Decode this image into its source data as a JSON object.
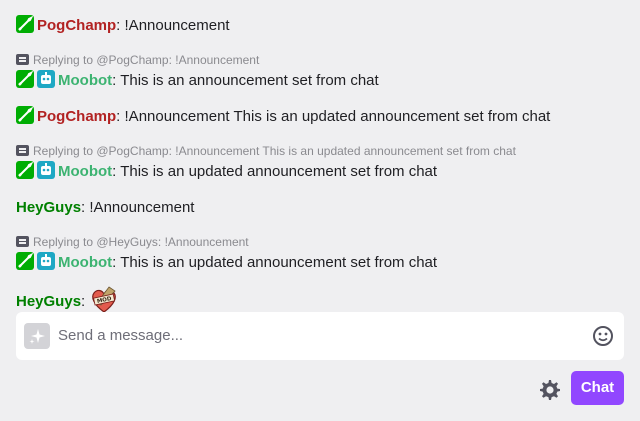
{
  "colors": {
    "pogchamp": "#b22222",
    "moobot": "#3cb371",
    "heyguys": "#008000",
    "accent": "#9147ff",
    "mod_badge": "#00ad03",
    "bot_badge": "#1ea8c4"
  },
  "messages": [
    {
      "type": "message",
      "badges": [
        "moderator-badge"
      ],
      "user": "PogChamp",
      "separator": ": ",
      "text": "!Announcement"
    },
    {
      "type": "reply",
      "text": "Replying to @PogChamp: !Announcement"
    },
    {
      "type": "message",
      "badges": [
        "moderator-badge",
        "bot-badge"
      ],
      "user": "Moobot",
      "separator": ": ",
      "text": "This is an announcement set from chat"
    },
    {
      "type": "message",
      "badges": [
        "moderator-badge"
      ],
      "user": "PogChamp",
      "separator": ": ",
      "text": "!Announcement This is an updated announcement set from chat"
    },
    {
      "type": "reply",
      "text": "Replying to @PogChamp: !Announcement This is an updated announcement set from chat"
    },
    {
      "type": "message",
      "badges": [
        "moderator-badge",
        "bot-badge"
      ],
      "user": "Moobot",
      "separator": ": ",
      "text": "This is an updated announcement set from chat"
    },
    {
      "type": "message",
      "badges": [],
      "user": "HeyGuys",
      "separator": ": ",
      "text": "!Announcement"
    },
    {
      "type": "reply",
      "text": "Replying to @HeyGuys: !Announcement"
    },
    {
      "type": "message",
      "badges": [
        "moderator-badge",
        "bot-badge"
      ],
      "user": "Moobot",
      "separator": ": ",
      "text": "This is an updated announcement set from chat"
    },
    {
      "type": "message",
      "badges": [],
      "user": "HeyGuys",
      "separator": ": ",
      "text": "",
      "emote": "mod-heart-emote",
      "emote_text": "MOD"
    }
  ],
  "input": {
    "placeholder": "Send a message...",
    "ai_icon": "sparkle-icon",
    "emoji_icon": "smiley-icon"
  },
  "footer": {
    "settings_icon": "gear-icon",
    "chat_label": "Chat"
  }
}
